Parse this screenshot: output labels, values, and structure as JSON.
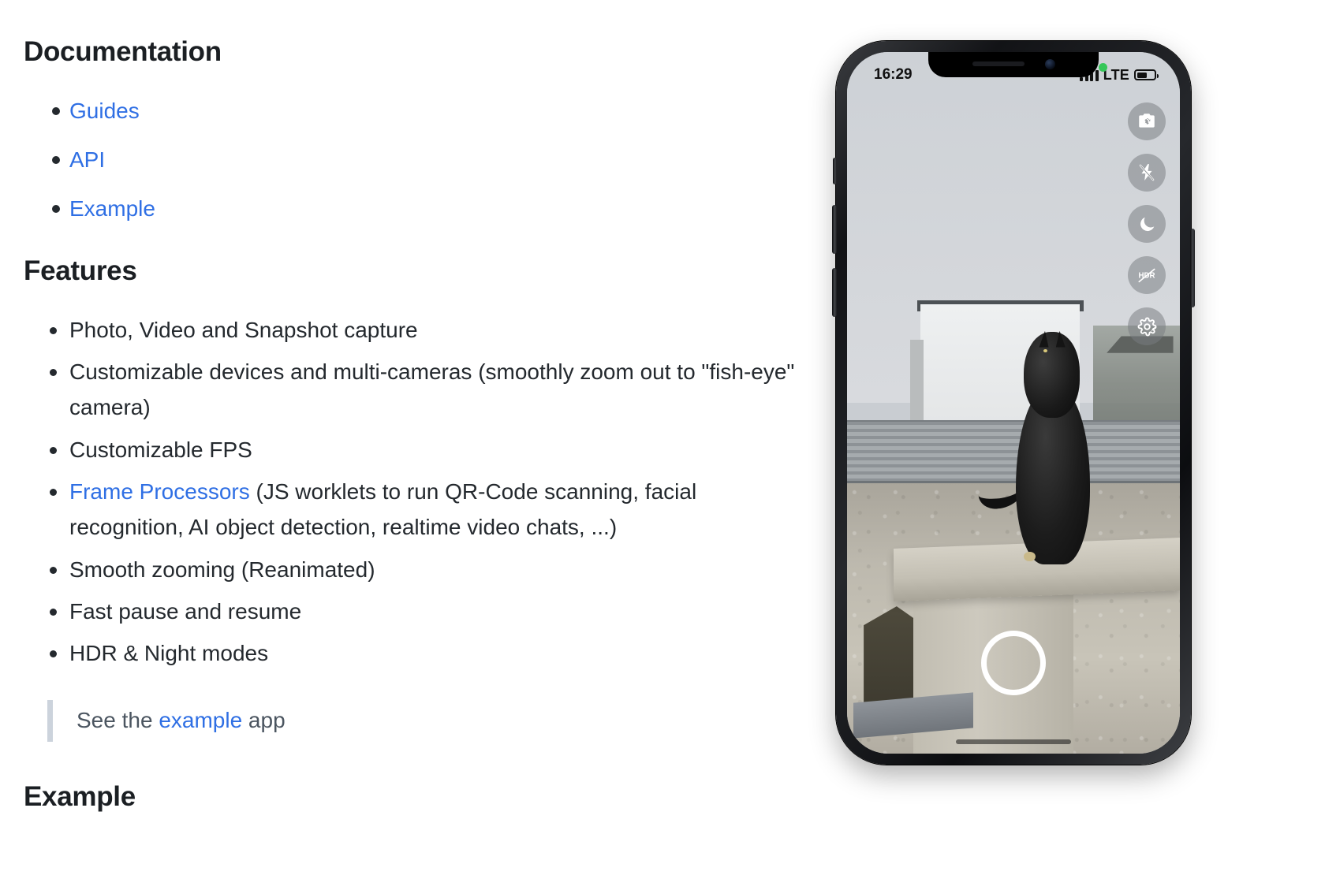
{
  "documentation": {
    "heading": "Documentation",
    "links": [
      {
        "label": "Guides"
      },
      {
        "label": "API"
      },
      {
        "label": "Example"
      }
    ]
  },
  "features": {
    "heading": "Features",
    "items": [
      {
        "text": "Photo, Video and Snapshot capture"
      },
      {
        "text": "Customizable devices and multi-cameras (smoothly zoom out to \"fish-eye\" camera)"
      },
      {
        "text": "Customizable FPS"
      },
      {
        "link": "Frame Processors",
        "text": " (JS worklets to run QR-Code scanning, facial recognition, AI object detection, realtime video chats, ...)"
      },
      {
        "text": "Smooth zooming (Reanimated)"
      },
      {
        "text": "Fast pause and resume"
      },
      {
        "text": "HDR & Night modes"
      }
    ]
  },
  "quote": {
    "prefix": "See the ",
    "link": "example",
    "suffix": " app"
  },
  "example": {
    "heading": "Example"
  },
  "phone": {
    "status": {
      "time": "16:29",
      "network": "LTE",
      "recording_indicator": "green-dot"
    },
    "controls": [
      {
        "name": "flip-camera-icon",
        "label": "Flip camera"
      },
      {
        "name": "flash-off-icon",
        "label": "Flash off"
      },
      {
        "name": "night-mode-icon",
        "label": "Night mode"
      },
      {
        "name": "hdr-off-icon",
        "label": "HDR off"
      },
      {
        "name": "settings-gear-icon",
        "label": "Settings"
      }
    ],
    "shutter_label": "Capture"
  },
  "colors": {
    "link": "#2f6fe4",
    "text": "#24292e",
    "quote_border": "#ccd3dc",
    "status_green": "#35c759"
  }
}
